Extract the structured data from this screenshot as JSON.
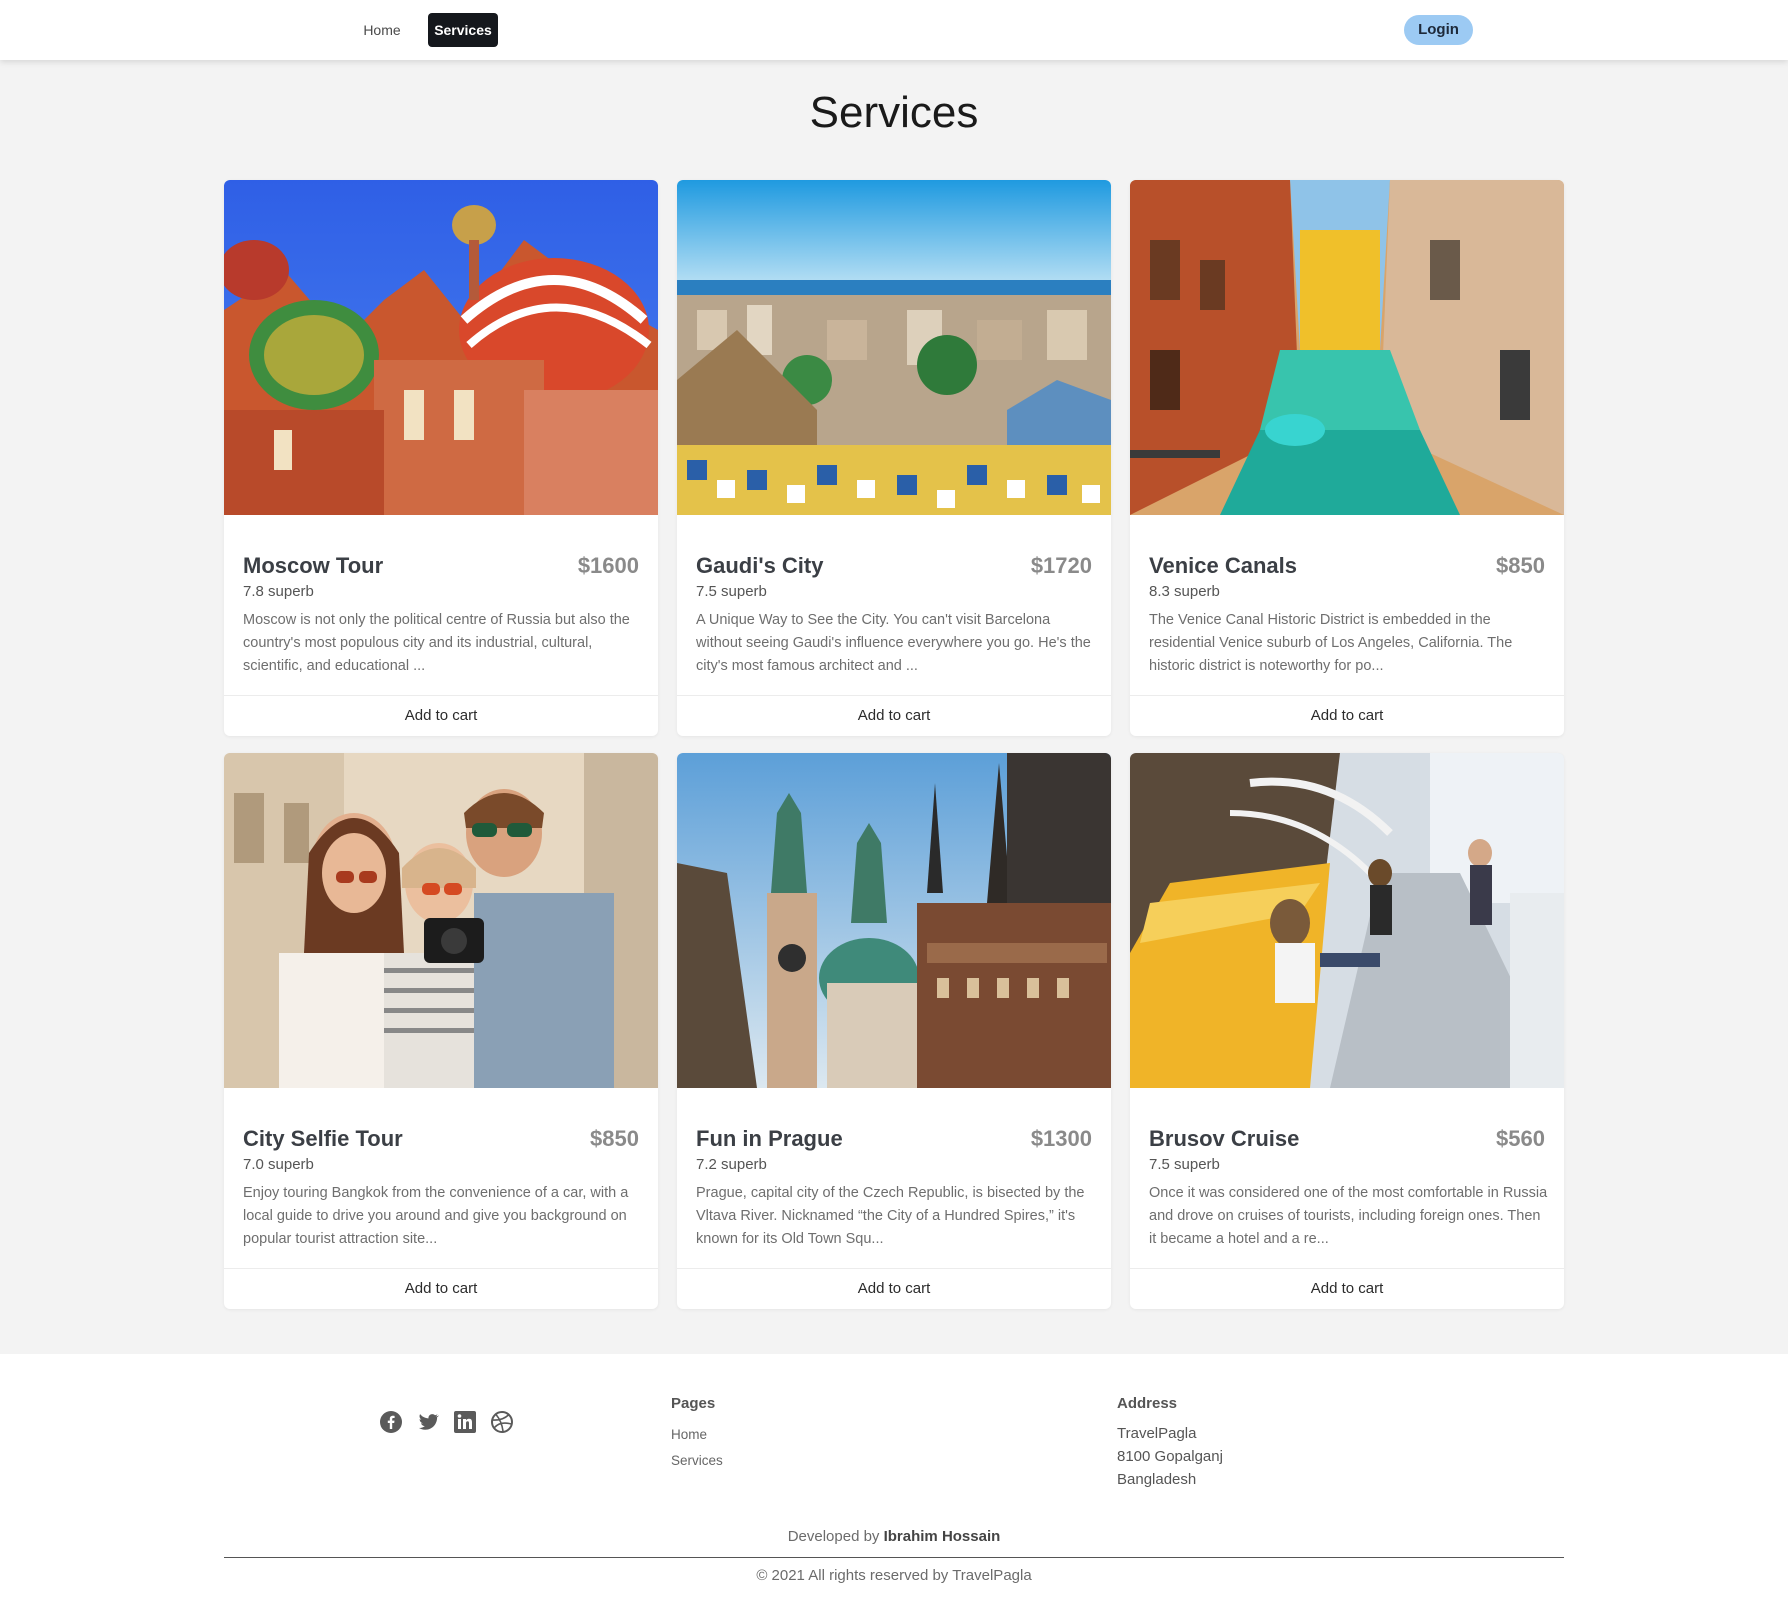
{
  "nav": {
    "home_label": "Home",
    "services_label": "Services",
    "login_label": "Login"
  },
  "page": {
    "title": "Services"
  },
  "cards": [
    {
      "title": "Moscow Tour",
      "price": "$1600",
      "rating": "7.8 superb",
      "description": "Moscow is not only the political centre of Russia but also the country's most populous city and its industrial, cultural, scientific, and educational ...",
      "cart_label": "Add to cart",
      "image": "moscow-cathedral-photo"
    },
    {
      "title": "Gaudi's City",
      "price": "$1720",
      "rating": "7.5 superb",
      "description": "A Unique Way to See the City. You can't visit Barcelona without seeing Gaudi's influence everywhere you go. He's the city's most famous architect and ...",
      "cart_label": "Add to cart",
      "image": "barcelona-park-photo"
    },
    {
      "title": "Venice Canals",
      "price": "$850",
      "rating": "8.3 superb",
      "description": "The Venice Canal Historic District is embedded in the residential Venice suburb of Los Angeles, California. The historic district is noteworthy for po...",
      "cart_label": "Add to cart",
      "image": "venice-canal-photo"
    },
    {
      "title": "City Selfie Tour",
      "price": "$850",
      "rating": "7.0 superb",
      "description": "Enjoy touring Bangkok from the convenience of a car, with a local guide to drive you around and give you background on popular tourist attraction site...",
      "cart_label": "Add to cart",
      "image": "friends-selfie-photo"
    },
    {
      "title": "Fun in Prague",
      "price": "$1300",
      "rating": "7.2 superb",
      "description": "Prague, capital city of the Czech Republic, is bisected by the Vltava River. Nicknamed “the City of a Hundred Spires,” it's known for its Old Town Squ...",
      "cart_label": "Add to cart",
      "image": "prague-spires-photo"
    },
    {
      "title": "Brusov Cruise",
      "price": "$560",
      "rating": "7.5 superb",
      "description": "Once it was considered one of the most comfortable in Russia and drove on cruises of tourists, including foreign ones. Then it became a hotel and a re...",
      "cart_label": "Add to cart",
      "image": "cruise-deck-photo"
    }
  ],
  "footer": {
    "socials": [
      "facebook-icon",
      "twitter-icon",
      "linkedin-icon",
      "dribbble-icon"
    ],
    "pages_heading": "Pages",
    "pages": [
      "Home",
      "Services"
    ],
    "address_heading": "Address",
    "address_lines": [
      "TravelPagla",
      "8100 Gopalganj",
      "Bangladesh"
    ],
    "developed_prefix": "Developed by",
    "developer": "Ibrahim Hossain",
    "copyright": "© 2021 All rights reserved by TravelPagla"
  },
  "colors": {
    "nav_active_bg": "#15181d",
    "login_bg": "#9ccaf3",
    "page_bg": "#f3f3f3"
  }
}
